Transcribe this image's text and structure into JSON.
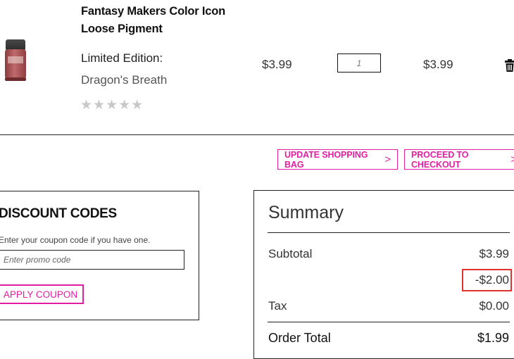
{
  "product": {
    "name": "Fantasy Makers Color Icon Loose Pigment",
    "edition_label": "Limited Edition:",
    "shade": "Dragon's Breath",
    "rating_stars": "★★★★★",
    "rating_value": 0,
    "price": "$3.99",
    "quantity": "1",
    "line_total": "$3.99"
  },
  "cart_actions": {
    "update_label": "UPDATE SHOPPING BAG",
    "checkout_label": "PROCEED TO CHECKOUT",
    "chevron": ">"
  },
  "discount": {
    "title": "DISCOUNT CODES",
    "help_text": "Enter your coupon code if you have one.",
    "placeholder": "Enter promo code",
    "apply_label": "APPLY COUPON"
  },
  "summary": {
    "title": "Summary",
    "subtotal_label": "Subtotal",
    "subtotal_value": "$3.99",
    "discount_value": "-$2.00",
    "tax_label": "Tax",
    "tax_value": "$0.00",
    "total_label": "Order Total",
    "total_value": "$1.99"
  },
  "colors": {
    "accent": "#e21fa3",
    "highlight": "#e0332f",
    "star_empty": "#c8c8c8"
  }
}
